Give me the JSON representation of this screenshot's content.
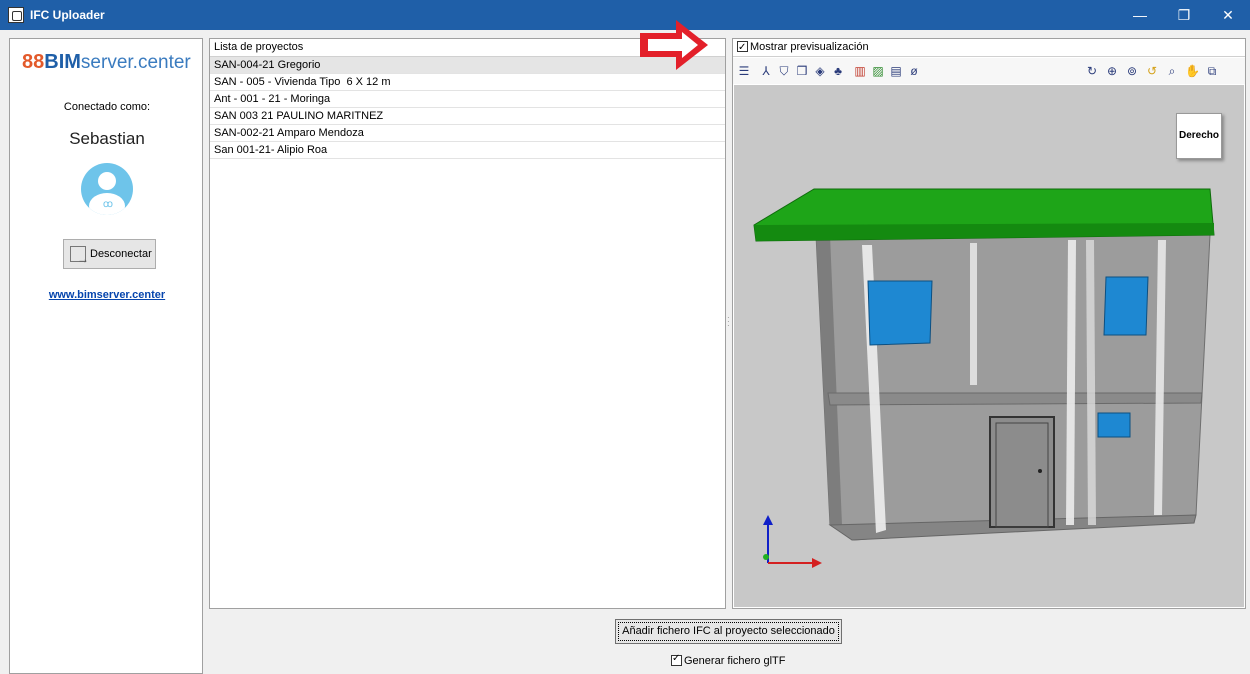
{
  "window": {
    "title": "IFC Uploader",
    "minimize": "—",
    "restore": "❐",
    "close": "✕"
  },
  "sidebar": {
    "logo_mark": "88",
    "logo_bold": "BIM",
    "logo_rest": "server.center",
    "connected_label": "Conectado como:",
    "username": "Sebastian",
    "avatar_badge": "ꝏ",
    "disconnect_label": "Desconectar",
    "site_link": "www.bimserver.center"
  },
  "projects": {
    "header": "Lista de proyectos",
    "rows": [
      "SAN-004-21 Gregorio",
      "SAN - 005 - Vivienda Tipo  6 X 12 m",
      "Ant - 001 - 21 - Moringa",
      "SAN 003 21 PAULINO MARITNEZ",
      "SAN-002-21 Amparo Mendoza",
      "San 001-21- Alipio Roa"
    ],
    "selected_index": 0
  },
  "preview": {
    "show_preview_label": "Mostrar previsualización",
    "show_preview_checked": true,
    "nav_cube_label": "Derecho",
    "toolbar_left_icons": [
      "layers-icon",
      "axes-icon",
      "shield-view-icon",
      "cubes-icon",
      "visibility-icon",
      "network-icon",
      "section-icon",
      "box-icon",
      "plan-icon",
      "eye-off-icon"
    ],
    "toolbar_right_icons": [
      "rotate-icon",
      "zoom-window-icon",
      "zoom-extents-icon",
      "refresh-icon",
      "zoom-icon",
      "pan-icon",
      "fit-icon"
    ]
  },
  "actions": {
    "add_ifc_label": "Añadir fichero IFC al proyecto seleccionado",
    "generate_gltf_label": "Generar fichero glTF",
    "generate_gltf_checked": true
  },
  "colors": {
    "titlebar": "#1f5fa8",
    "roof": "#1ea518",
    "window_glass": "#1e88d2",
    "wall": "#9a9a9a",
    "arrow": "#e3202a"
  }
}
